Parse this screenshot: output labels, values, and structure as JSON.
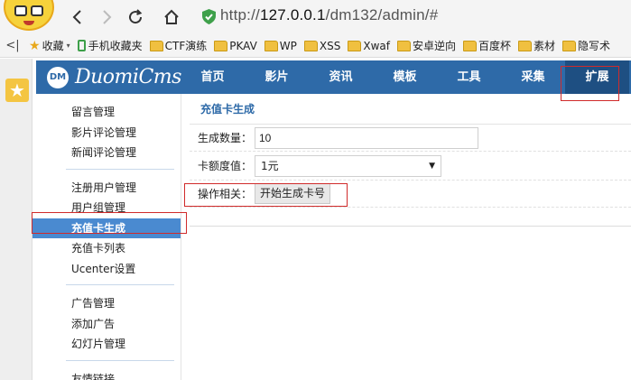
{
  "browser": {
    "url_prefix": "http://",
    "url_host": "127.0.0.1",
    "url_path": "/dm132/admin/#",
    "bookmarks_toggle": "<|",
    "bookmarks": [
      {
        "label": "收藏",
        "icon": "star-icon"
      },
      {
        "label": "手机收藏夹",
        "icon": "phone-icon"
      },
      {
        "label": "CTF演练",
        "icon": "folder-icon"
      },
      {
        "label": "PKAV",
        "icon": "folder-icon"
      },
      {
        "label": "WP",
        "icon": "folder-icon"
      },
      {
        "label": "XSS",
        "icon": "folder-icon"
      },
      {
        "label": "Xwaf",
        "icon": "folder-icon"
      },
      {
        "label": "安卓逆向",
        "icon": "folder-icon"
      },
      {
        "label": "百度杯",
        "icon": "folder-icon"
      },
      {
        "label": "素材",
        "icon": "folder-icon"
      },
      {
        "label": "隐写术",
        "icon": "folder-icon"
      }
    ]
  },
  "cms": {
    "logo_mark": "DM",
    "logo_text": "DuomiCms",
    "nav": [
      "首页",
      "影片",
      "资讯",
      "模板",
      "工具",
      "采集",
      "扩展"
    ],
    "active_nav": "扩展"
  },
  "sidebar": {
    "groups": [
      [
        "留言管理",
        "影片评论管理",
        "新闻评论管理"
      ],
      [
        "注册用户管理",
        "用户组管理",
        "充值卡生成",
        "充值卡列表",
        "Ucenter设置"
      ],
      [
        "广告管理",
        "添加广告",
        "幻灯片管理"
      ],
      [
        "友情链接"
      ]
    ],
    "active_item": "充值卡生成"
  },
  "main": {
    "title": "充值卡生成",
    "quantity_label": "生成数量：",
    "quantity_value": "10",
    "amount_label": "卡额度值：",
    "amount_value": "1元",
    "action_label": "操作相关：",
    "generate_button": "开始生成卡号"
  },
  "colors": {
    "header_blue": "#2e6aa8",
    "active_nav": "#1e4f82",
    "sidebar_active": "#4a8ad0",
    "annotation_red": "#d02b2b"
  }
}
